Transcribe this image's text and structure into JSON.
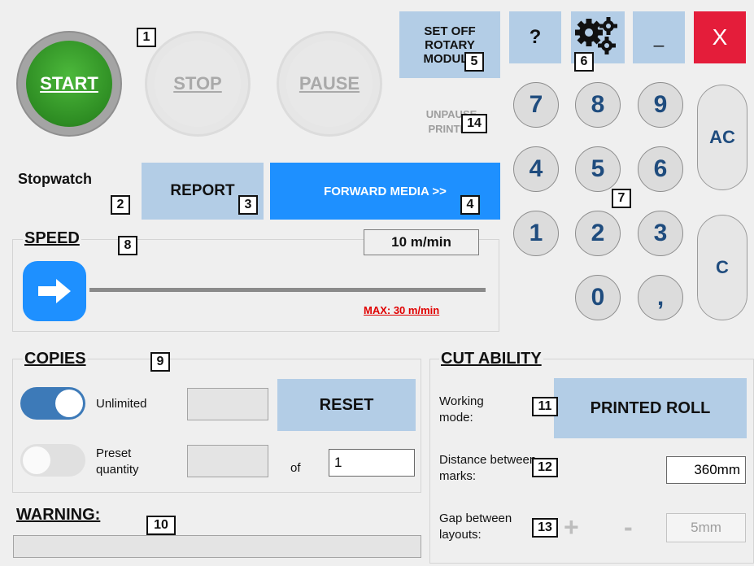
{
  "controls": {
    "start_label": "START",
    "stop_label": "STOP",
    "pause_label": "PAUSE",
    "set_off_rotary_label": "SET OFF\nROTARY\nMODULE",
    "unpause_printer_label": "UNPAUSE\nPRINTER",
    "stopwatch_label": "Stopwatch",
    "report_label": "REPORT",
    "forward_media_label": "FORWARD MEDIA >>"
  },
  "window": {
    "help_label": "?",
    "minimize_label": "_",
    "close_label": "X"
  },
  "keypad": {
    "keys": [
      "7",
      "8",
      "9",
      "4",
      "5",
      "6",
      "1",
      "2",
      "3",
      "0",
      ","
    ],
    "ac_label": "AC",
    "c_label": "C"
  },
  "speed": {
    "title": "SPEED",
    "value_text": "10 m/min",
    "max_text": "MAX: 30 m/min",
    "current": 10,
    "max": 30
  },
  "copies": {
    "title": "COPIES",
    "unlimited_label": "Unlimited",
    "unlimited_on": true,
    "reset_label": "RESET",
    "preset_label": "Preset\nquantity",
    "preset_on": false,
    "of_label": "of",
    "of_value": "1"
  },
  "warning": {
    "title": "WARNING:",
    "text": ""
  },
  "cut_ability": {
    "title": "CUT ABILITY",
    "working_mode_label": "Working\nmode:",
    "working_mode_value": "PRINTED ROLL",
    "distance_label": "Distance between\nmarks:",
    "distance_value": "360mm",
    "gap_label": "Gap between\nlayouts:",
    "gap_plus": "+",
    "gap_minus": "-",
    "gap_value": "5mm"
  },
  "callouts": [
    "1",
    "2",
    "3",
    "4",
    "5",
    "6",
    "7",
    "8",
    "9",
    "10",
    "11",
    "12",
    "13",
    "14"
  ],
  "colors": {
    "accent_blue": "#1e90ff",
    "light_blue": "#b3cde6",
    "start_green": "#2e8d23",
    "close_red": "#e41d3a",
    "max_red": "#e00000"
  }
}
